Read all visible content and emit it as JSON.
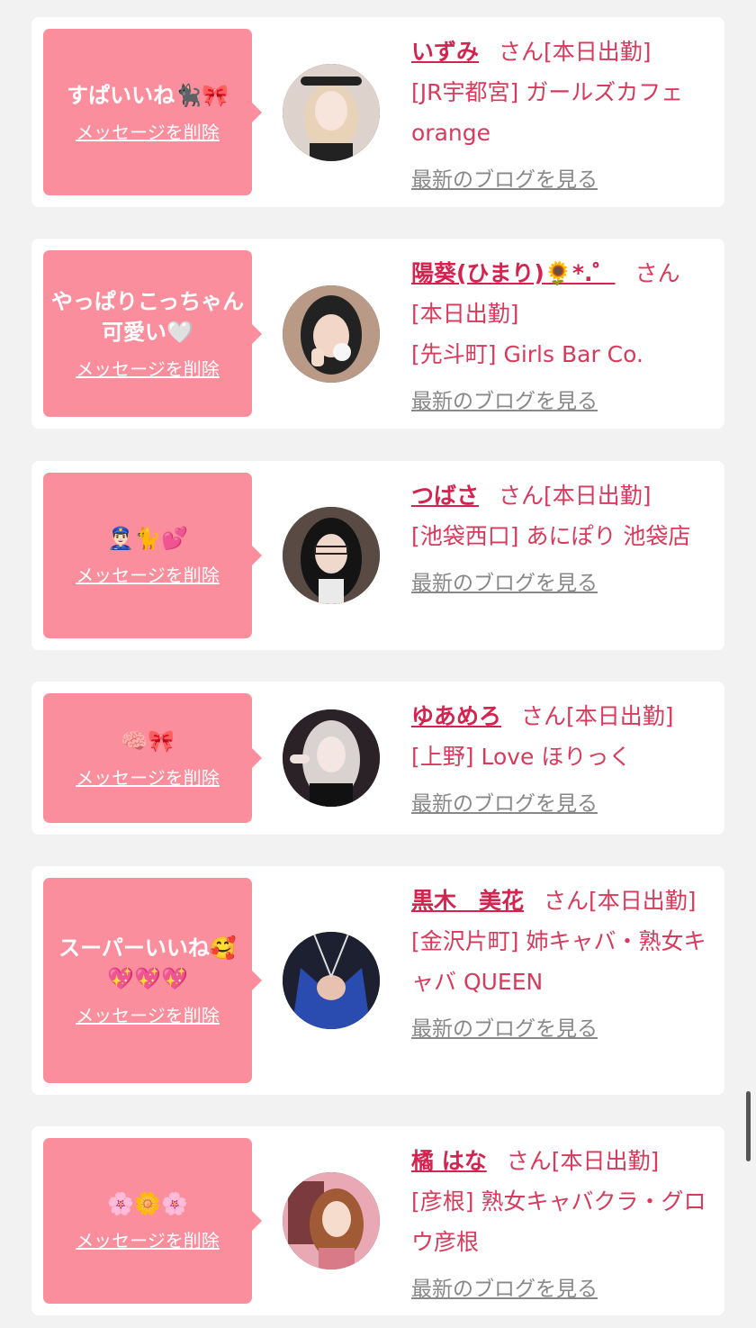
{
  "cards": [
    {
      "message": "すぱいいね🐈‍⬛🎀",
      "delete_label": "メッセージを削除",
      "name": "いずみ",
      "san": "さん",
      "status": "[本日出勤]",
      "shop": "[JR宇都宮] ガールズカフェ orange",
      "blog_label": "最新のブログを見る",
      "avatar_bg": "#e8e0dc"
    },
    {
      "message": "やっぱりこっちゃん可愛い🤍",
      "delete_label": "メッセージを削除",
      "name": "陽葵(ひまり)🌻*.゜",
      "san": "さん",
      "status": "[本日出勤]",
      "shop": "[先斗町] Girls Bar Co.",
      "blog_label": "最新のブログを見る",
      "avatar_bg": "#8a6a5a"
    },
    {
      "message": "👮🏻‍♂️🐈💕",
      "delete_label": "メッセージを削除",
      "name": "つばさ",
      "san": "さん",
      "status": "[本日出勤]",
      "shop": "[池袋西口] あにぽり 池袋店",
      "blog_label": "最新のブログを見る",
      "avatar_bg": "#4a3a36"
    },
    {
      "message": "🧠🎀",
      "delete_label": "メッセージを削除",
      "name": "ゆあめろ",
      "san": "さん",
      "status": "[本日出勤]",
      "shop": "[上野] Love ほりっく",
      "blog_label": "最新のブログを見る",
      "avatar_bg": "#2a2226"
    },
    {
      "message": "スーパーいいね🥰💖💖💖",
      "delete_label": "メッセージを削除",
      "name": "黒木　美花",
      "san": "さん",
      "status": "[本日出勤]",
      "shop": "[金沢片町] 姉キャバ・熟女キャバ QUEEN",
      "blog_label": "最新のブログを見る",
      "avatar_bg": "#23336e"
    },
    {
      "message": "🌸🌼🌸",
      "delete_label": "メッセージを削除",
      "name": "橘 はな",
      "san": "さん",
      "status": "[本日出勤]",
      "shop": "[彦根] 熟女キャバクラ・グロウ彦根",
      "blog_label": "最新のブログを見る",
      "avatar_bg": "#c86a78"
    }
  ]
}
